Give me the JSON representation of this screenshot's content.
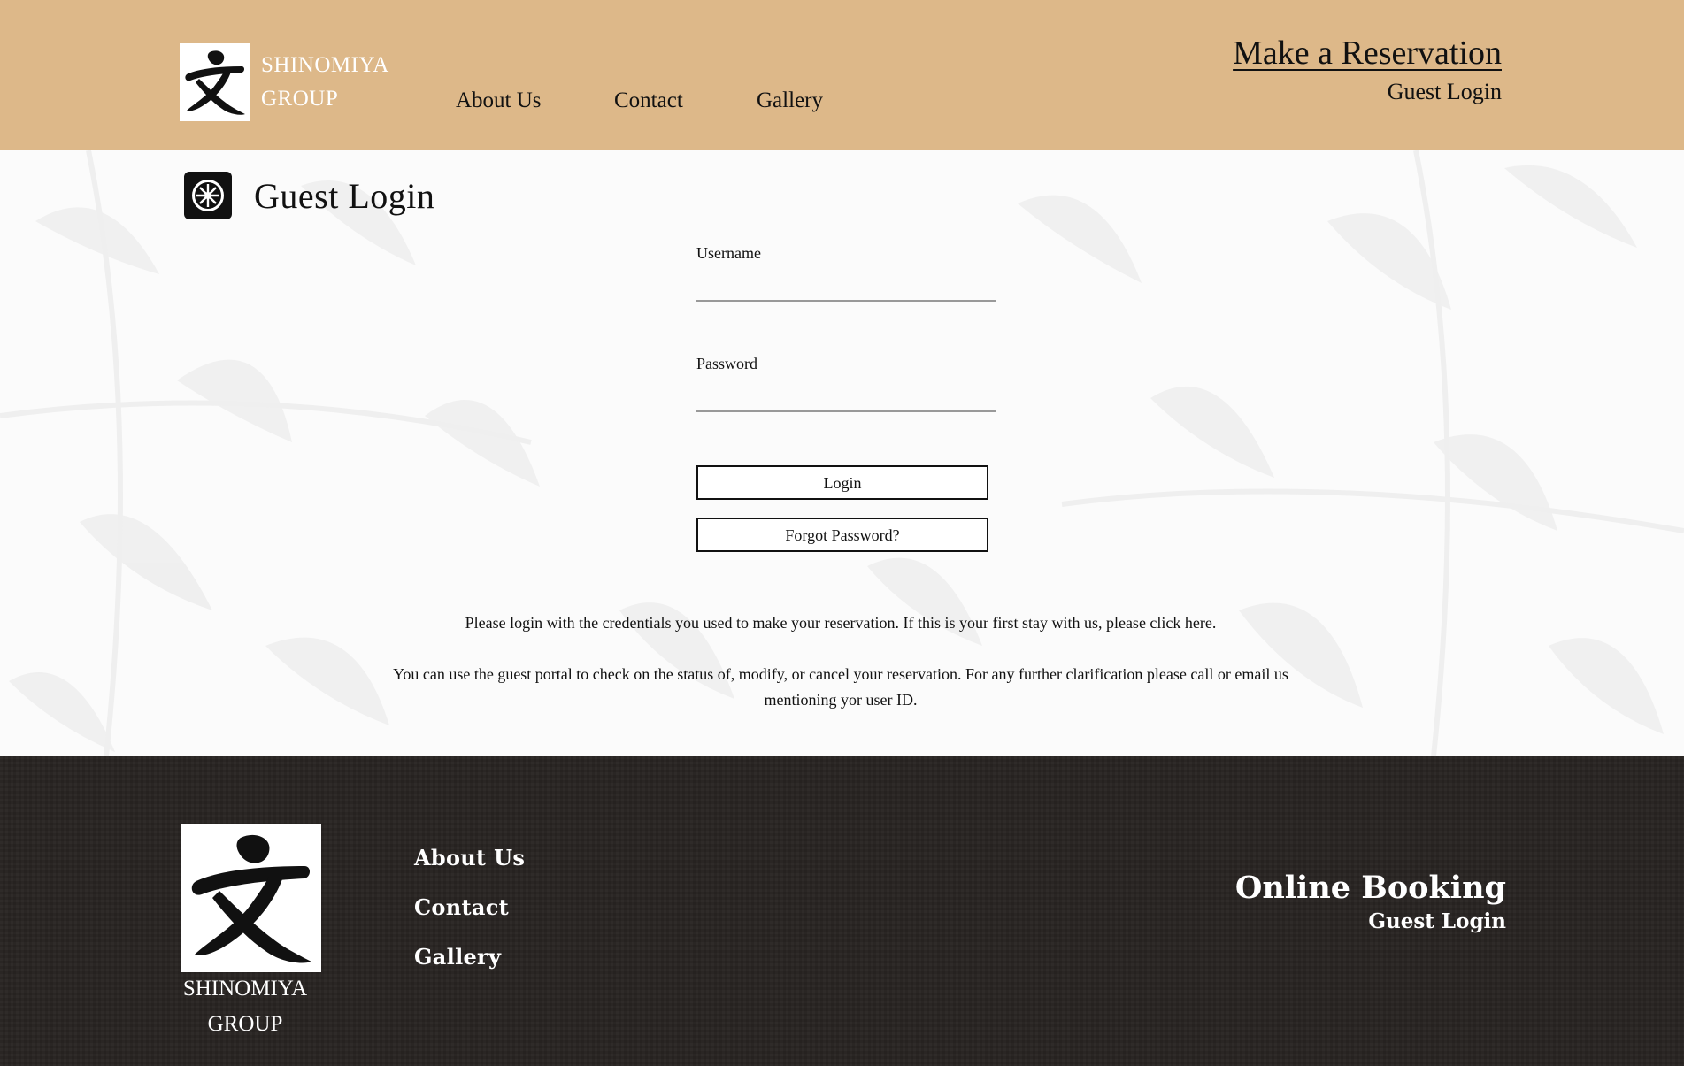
{
  "header": {
    "brand_line1": "SHINOMIYA",
    "brand_line2": "GROUP",
    "logo_icon": "kanji-logo-icon",
    "nav": [
      "About Us",
      "Contact",
      "Gallery"
    ],
    "reservation": "Make a Reservation",
    "guest_login": "Guest Login",
    "background_color": "#ddb889"
  },
  "main": {
    "title": "Guest Login",
    "title_icon": "crest-icon",
    "username_label": "Username",
    "username_value": "",
    "password_label": "Password",
    "password_value": "",
    "login_button": "Login",
    "forgot_button": "Forgot Password?",
    "info_text_1": "Please login with the credentials you used to make your reservation. If this is your first stay with us, please click here.",
    "info_text_2": "You can use the guest portal to check on the status of, modify, or cancel your reservation. For any further clarification please call or email us mentioning yor user ID."
  },
  "footer": {
    "brand_line1": "SHINOMIYA",
    "brand_line2": "GROUP",
    "nav": [
      "About Us",
      "Contact",
      "Gallery"
    ],
    "online_booking": "Online Booking",
    "guest_login": "Guest Login",
    "background_color": "#2a2624"
  }
}
